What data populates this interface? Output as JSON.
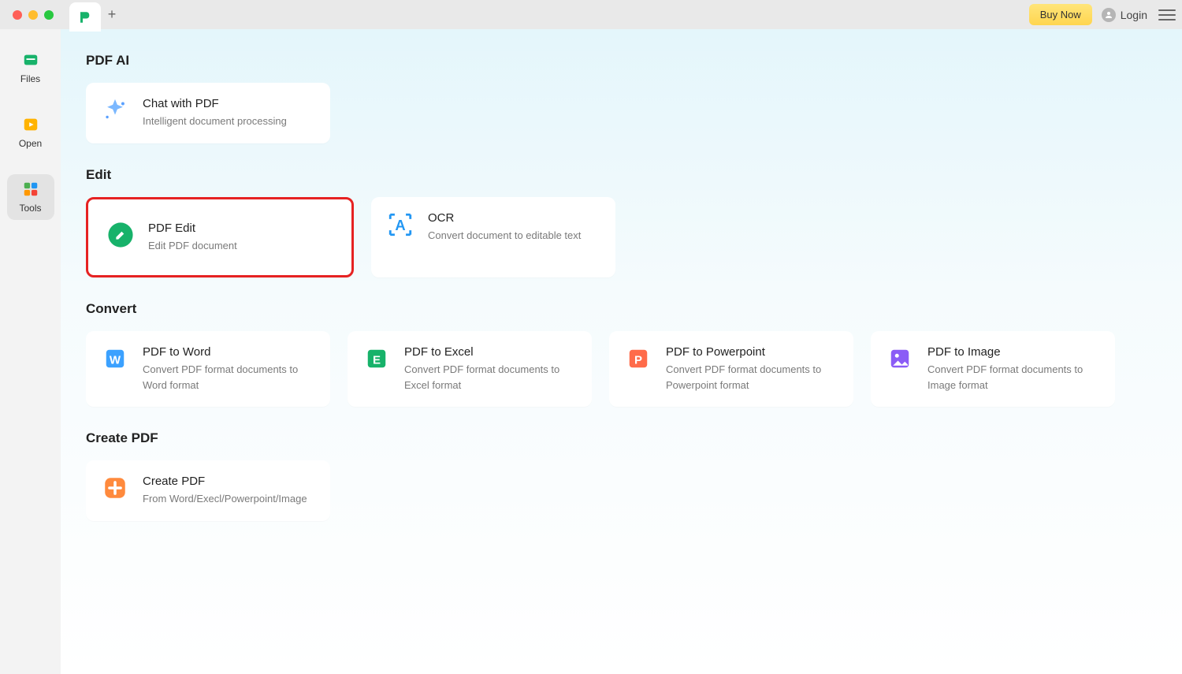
{
  "titlebar": {
    "buy_now": "Buy Now",
    "login": "Login"
  },
  "sidebar": {
    "items": [
      {
        "label": "Files"
      },
      {
        "label": "Open"
      },
      {
        "label": "Tools"
      }
    ]
  },
  "sections": {
    "pdf_ai": {
      "title": "PDF AI",
      "cards": [
        {
          "title": "Chat with PDF",
          "desc": "Intelligent document processing"
        }
      ]
    },
    "edit": {
      "title": "Edit",
      "cards": [
        {
          "title": "PDF Edit",
          "desc": "Edit PDF document"
        },
        {
          "title": "OCR",
          "desc": "Convert document to editable text"
        }
      ]
    },
    "convert": {
      "title": "Convert",
      "cards": [
        {
          "title": "PDF to Word",
          "desc": "Convert PDF format documents to Word format"
        },
        {
          "title": "PDF to Excel",
          "desc": "Convert PDF format documents to Excel format"
        },
        {
          "title": "PDF to Powerpoint",
          "desc": "Convert PDF format documents to Powerpoint format"
        },
        {
          "title": "PDF to Image",
          "desc": "Convert PDF format documents to Image format"
        }
      ]
    },
    "create": {
      "title": "Create PDF",
      "cards": [
        {
          "title": "Create PDF",
          "desc": "From Word/Execl/Powerpoint/Image"
        }
      ]
    }
  }
}
